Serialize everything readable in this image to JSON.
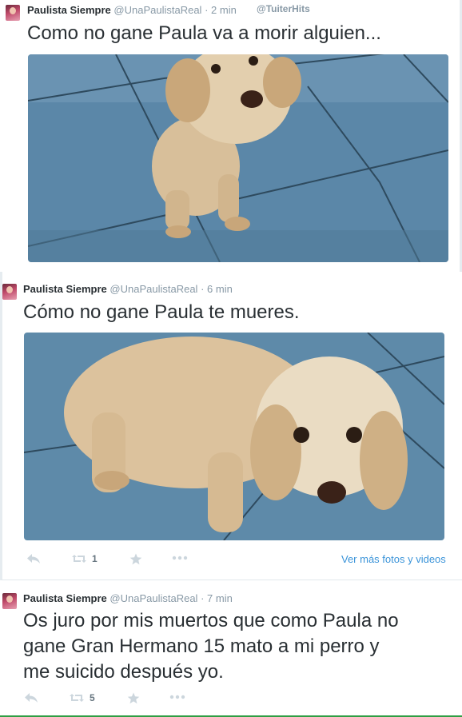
{
  "tweets": [
    {
      "author_name": "Paulista Siempre",
      "handle": "@UnaPaulistaReal",
      "separator": "·",
      "time": "2 min",
      "watermark": "@TuiterHits",
      "text": "Como no gane Paula va a morir alguien..."
    },
    {
      "author_name": "Paulista Siempre",
      "handle": "@UnaPaulistaReal",
      "separator": "·",
      "time": "6 min",
      "text": "Cómo no gane Paula te mueres.",
      "retweet_count": "1",
      "media_link": "Ver más fotos y videos"
    },
    {
      "author_name": "Paulista Siempre",
      "handle": "@UnaPaulistaReal",
      "separator": "·",
      "time": "7 min",
      "text_lines": [
        "Os juro por mis muertos que como Paula no",
        "gane Gran Hermano 15 mato a mi perro y",
        "me suicido después yo."
      ],
      "retweet_count": "5"
    }
  ],
  "icons": {
    "reply": "reply-icon",
    "retweet": "retweet-icon",
    "favorite": "star-icon",
    "more": "more-dots-icon"
  },
  "colors": {
    "link": "#3b94d9",
    "meta": "#8899a6",
    "action_icon": "#ccd6dd",
    "tile_floor": "#5b87a8",
    "dog_fur": "#d8bf9a"
  }
}
